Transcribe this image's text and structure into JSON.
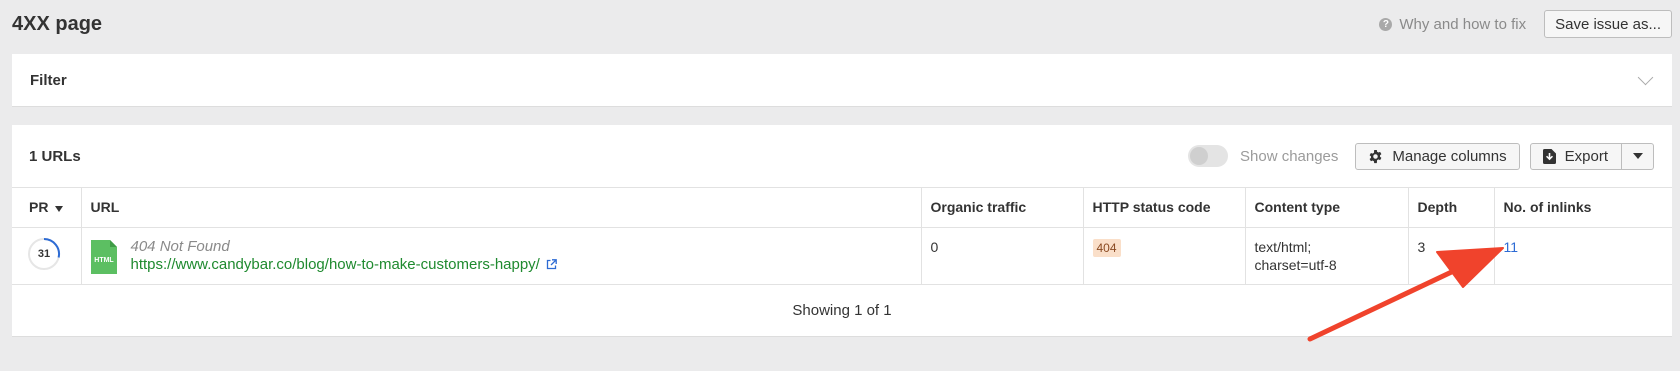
{
  "header": {
    "title": "4XX page",
    "help_label": "Why and how to fix",
    "save_label": "Save issue as..."
  },
  "filter": {
    "label": "Filter"
  },
  "results": {
    "count_label": "1 URLs",
    "show_changes_label": "Show changes",
    "manage_columns_label": "Manage columns",
    "export_label": "Export",
    "columns": {
      "pr": "PR",
      "url": "URL",
      "organic_traffic": "Organic traffic",
      "http_status": "HTTP status code",
      "content_type": "Content type",
      "depth": "Depth",
      "inlinks": "No. of inlinks"
    },
    "rows": [
      {
        "pr": "31",
        "file_type": "HTML",
        "title": "404 Not Found",
        "url": "https://www.candybar.co/blog/how-to-make-customers-happy/",
        "organic_traffic": "0",
        "http_status": "404",
        "content_type_line1": "text/html;",
        "content_type_line2": "charset=utf-8",
        "depth": "3",
        "inlinks": "11"
      }
    ],
    "footer": "Showing 1 of 1"
  },
  "colors": {
    "url_green": "#1f8a2f",
    "link_blue": "#2d6bd4",
    "status_badge_bg": "#fadfc9",
    "file_icon_green": "#5cbf62",
    "annotation_arrow": "#f0432c"
  },
  "icons": [
    "help-icon",
    "chevron-down-icon",
    "gear-icon",
    "export-icon",
    "caret-down-icon",
    "sort-desc-icon",
    "html-file-icon",
    "external-link-icon"
  ]
}
